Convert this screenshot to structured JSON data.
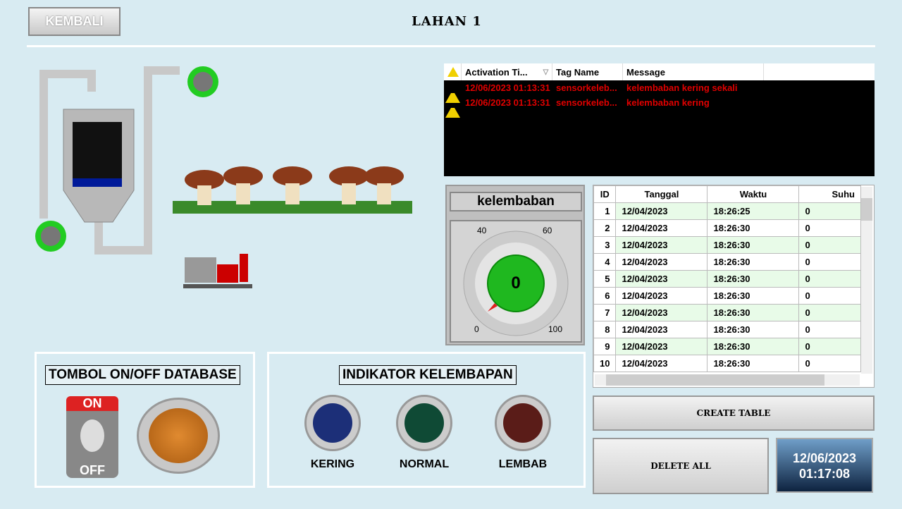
{
  "header": {
    "back_label": "KEMBALI",
    "title": "LAHAN 1"
  },
  "alarm": {
    "columns": [
      "Activation Ti...",
      "Tag Name",
      "Message"
    ],
    "rows": [
      {
        "time": "12/06/2023 01:13:31",
        "tag": "sensorkeleb...",
        "message": "kelembaban kering sekali"
      },
      {
        "time": "12/06/2023 01:13:31",
        "tag": "sensorkeleb...",
        "message": "kelembaban kering"
      }
    ]
  },
  "gauge": {
    "label": "kelembaban",
    "value": "0",
    "ticks": [
      "0",
      "40",
      "60",
      "100"
    ]
  },
  "table": {
    "columns": [
      "ID",
      "Tanggal",
      "Waktu",
      "Suhu"
    ],
    "rows": [
      [
        "1",
        "12/04/2023",
        "18:26:25",
        "0"
      ],
      [
        "2",
        "12/04/2023",
        "18:26:30",
        "0"
      ],
      [
        "3",
        "12/04/2023",
        "18:26:30",
        "0"
      ],
      [
        "4",
        "12/04/2023",
        "18:26:30",
        "0"
      ],
      [
        "5",
        "12/04/2023",
        "18:26:30",
        "0"
      ],
      [
        "6",
        "12/04/2023",
        "18:26:30",
        "0"
      ],
      [
        "7",
        "12/04/2023",
        "18:26:30",
        "0"
      ],
      [
        "8",
        "12/04/2023",
        "18:26:30",
        "0"
      ],
      [
        "9",
        "12/04/2023",
        "18:26:30",
        "0"
      ],
      [
        "10",
        "12/04/2023",
        "18:26:30",
        "0"
      ]
    ]
  },
  "buttons": {
    "create": "CREATE TABLE",
    "delete": "DELETE ALL"
  },
  "datetime": {
    "date": "12/06/2023",
    "time": "01:17:08"
  },
  "database": {
    "title": "TOMBOL ON/OFF DATABASE",
    "on": "ON",
    "off": "OFF"
  },
  "indicator": {
    "title": "INDIKATOR KELEMBAPAN",
    "lamps": [
      {
        "label": "KERING",
        "color": "#1c2f78"
      },
      {
        "label": "NORMAL",
        "color": "#0f4a35"
      },
      {
        "label": "LEMBAB",
        "color": "#5a1c18"
      }
    ]
  }
}
